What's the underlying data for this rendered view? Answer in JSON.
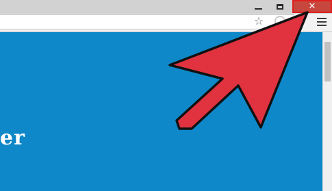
{
  "window": {
    "minimize_icon": "minimize-icon",
    "maximize_icon": "restore-icon",
    "close_glyph": "✕"
  },
  "toolbar": {
    "bookmark_glyph": "☆",
    "bookmark_icon": "star-icon",
    "extension_icon": "extension-icon",
    "menu_icon": "hamburger-menu-icon"
  },
  "page": {
    "visible_text": "er",
    "background_color": "#0e88c9"
  },
  "annotation": {
    "arrow_color": "#e0323f",
    "arrow_outline": "#111111",
    "highlight_color": "#e02020"
  }
}
